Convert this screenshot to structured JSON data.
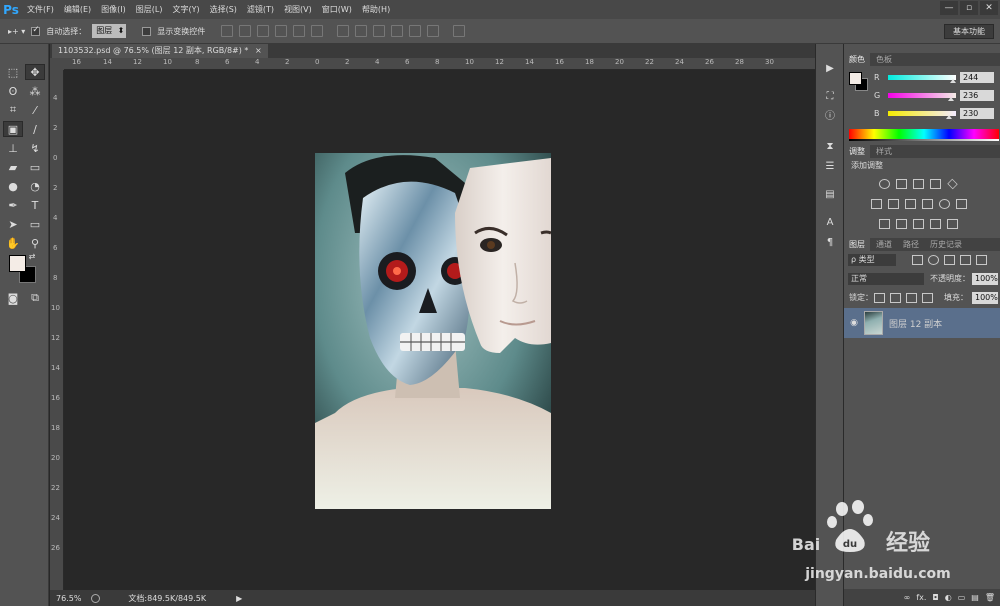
{
  "app": {
    "logo": "Ps"
  },
  "menu": [
    "文件(F)",
    "编辑(E)",
    "图像(I)",
    "图层(L)",
    "文字(Y)",
    "选择(S)",
    "滤镜(T)",
    "视图(V)",
    "窗口(W)",
    "帮助(H)"
  ],
  "window_controls": [
    "—",
    "▫",
    "✕"
  ],
  "options": {
    "tool_icon": "▸+ ▾",
    "auto_select_label": "自动选择：",
    "auto_select_value": "图层",
    "transform_label": "显示变换控件"
  },
  "workspace": "基本功能",
  "document": {
    "tab_title": "1103532.psd @ 76.5% (图层 12 副本, RGB/8#) *",
    "tab_close": "×"
  },
  "ruler_h": [
    "16",
    "14",
    "12",
    "10",
    "8",
    "6",
    "4",
    "2",
    "0",
    "2",
    "4",
    "6",
    "8",
    "10",
    "12",
    "14",
    "16",
    "18",
    "20",
    "22",
    "24",
    "26",
    "28",
    "30"
  ],
  "ruler_v": [
    "4",
    "2",
    "0",
    "2",
    "4",
    "6",
    "8",
    "10",
    "12",
    "14",
    "16",
    "18",
    "20",
    "22",
    "24",
    "26"
  ],
  "status": {
    "zoom": "76.5%",
    "doc_info": "文档:849.5K/849.5K",
    "arrow": "▶"
  },
  "color_panel": {
    "tabs": [
      "颜色",
      "色板"
    ],
    "channels": [
      {
        "label": "R",
        "value": "244",
        "gradient": "linear-gradient(90deg,#00ecde,#fff)",
        "marker": 0.957
      },
      {
        "label": "G",
        "value": "236",
        "gradient": "linear-gradient(90deg,#f400e6,#f4ece6)",
        "marker": 0.925
      },
      {
        "label": "B",
        "value": "230",
        "gradient": "linear-gradient(90deg,#f4ec00,#f4ecff)",
        "marker": 0.902
      }
    ]
  },
  "adjustments": {
    "tabs": [
      "调整",
      "样式"
    ],
    "title": "添加调整"
  },
  "layers_panel": {
    "tabs": [
      "图层",
      "通道",
      "路径",
      "历史记录"
    ],
    "filter": "ρ 类型",
    "blend_mode": "正常",
    "opacity_label": "不透明度：",
    "opacity_value": "100%",
    "lock_label": "锁定：",
    "fill_label": "填充：",
    "fill_value": "100%",
    "layer_name": "图层 12 副本",
    "eye": "◉",
    "footer": [
      "∞",
      "fx.",
      "◘",
      "◐",
      "▭",
      "▤",
      "🗑"
    ]
  },
  "watermark": {
    "brand": "Bai",
    "du": "du",
    "jingyan": "经验",
    "url": "jingyan.baidu.com"
  },
  "colors": {
    "foreground": "#f4ece6",
    "background": "#000000",
    "accent": "#31a8ff",
    "selection": "#5a6f8c"
  }
}
